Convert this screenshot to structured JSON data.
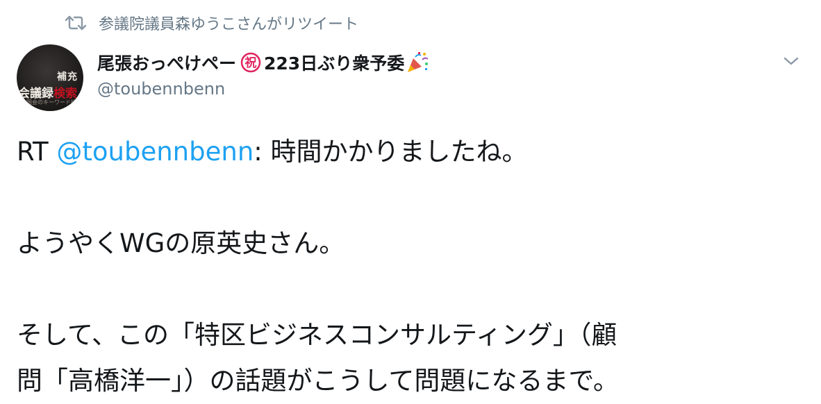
{
  "retweet": {
    "text": "参議院議員森ゆうこさんがリツイート",
    "icon": "retweet-icon"
  },
  "author": {
    "display_name": "尾張おっぺけペー",
    "badge_char": "祝",
    "name_suffix": "223日ぶり衆予委",
    "party_icon": "party-popper-icon",
    "handle": "@toubennbenn",
    "avatar": {
      "line1": "補充",
      "line2_white": "会議録",
      "line2_red": "検索",
      "line3": "国会のキーワード検索"
    }
  },
  "menu_icon": "chevron-down-icon",
  "tweet": {
    "line1_prefix": "RT ",
    "mention": "@toubennbenn",
    "line1_suffix": ": 時間かかりましたね。",
    "line2": "",
    "line3": "ようやくWGの原英史さん。",
    "line4": "",
    "line5": "そして、この「特区ビジネスコンサルティング」（顧",
    "line6": "問「高橋洋一」）の話題がこうして問題になるまで。"
  },
  "colors": {
    "accent": "#1da1f2",
    "muted": "#657786",
    "text": "#14171a",
    "badge_red": "#e0245e"
  }
}
